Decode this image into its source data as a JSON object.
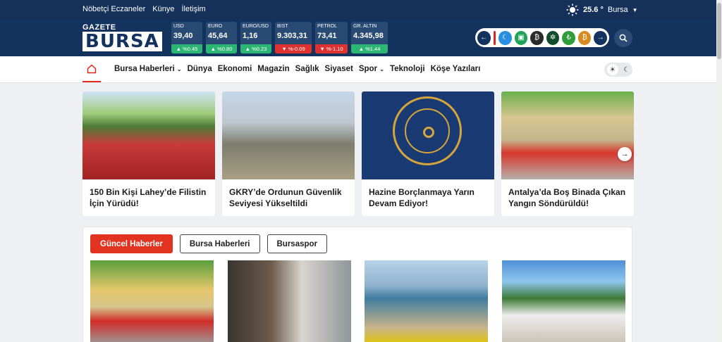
{
  "topbar": {
    "links": [
      "Nöbetçi Eczaneler",
      "Künye",
      "İletişim"
    ],
    "weather": {
      "temp": "25.6 °",
      "city": "Bursa"
    }
  },
  "logo": {
    "top": "GAZETE",
    "main": "BURSA"
  },
  "markets": [
    {
      "name": "USD",
      "value": "39,40",
      "change": "%0.45",
      "dir": "up"
    },
    {
      "name": "EURO",
      "value": "45,64",
      "change": "%0.80",
      "dir": "up"
    },
    {
      "name": "EURO/USD",
      "value": "1,16",
      "change": "%0.23",
      "dir": "up"
    },
    {
      "name": "BIST",
      "value": "9.303,31",
      "change": "%-0.09",
      "dir": "down"
    },
    {
      "name": "PETROL",
      "value": "73,41",
      "change": "%-1.10",
      "dir": "down"
    },
    {
      "name": "GR. ALTIN",
      "value": "4.345,98",
      "change": "%1.44",
      "dir": "up"
    }
  ],
  "nav": {
    "items": [
      "Bursa Haberleri",
      "Dünya",
      "Ekonomi",
      "Magazin",
      "Sağlık",
      "Siyaset",
      "Spor",
      "Teknoloji",
      "Köşe Yazıları"
    ]
  },
  "cards": [
    {
      "title": "150 Bin Kişi Lahey’de Filistin İçin Yürüdü!"
    },
    {
      "title": "GKRY’de Ordunun Güvenlik Seviyesi Yükseltildi"
    },
    {
      "title": "Hazine Borçlanmaya Yarın Devam Ediyor!"
    },
    {
      "title": "Antalya’da Boş Binada Çıkan Yangın Söndürüldü!"
    }
  ],
  "tabs": [
    "Güncel Haberler",
    "Bursa Haberleri",
    "Bursaspor"
  ]
}
